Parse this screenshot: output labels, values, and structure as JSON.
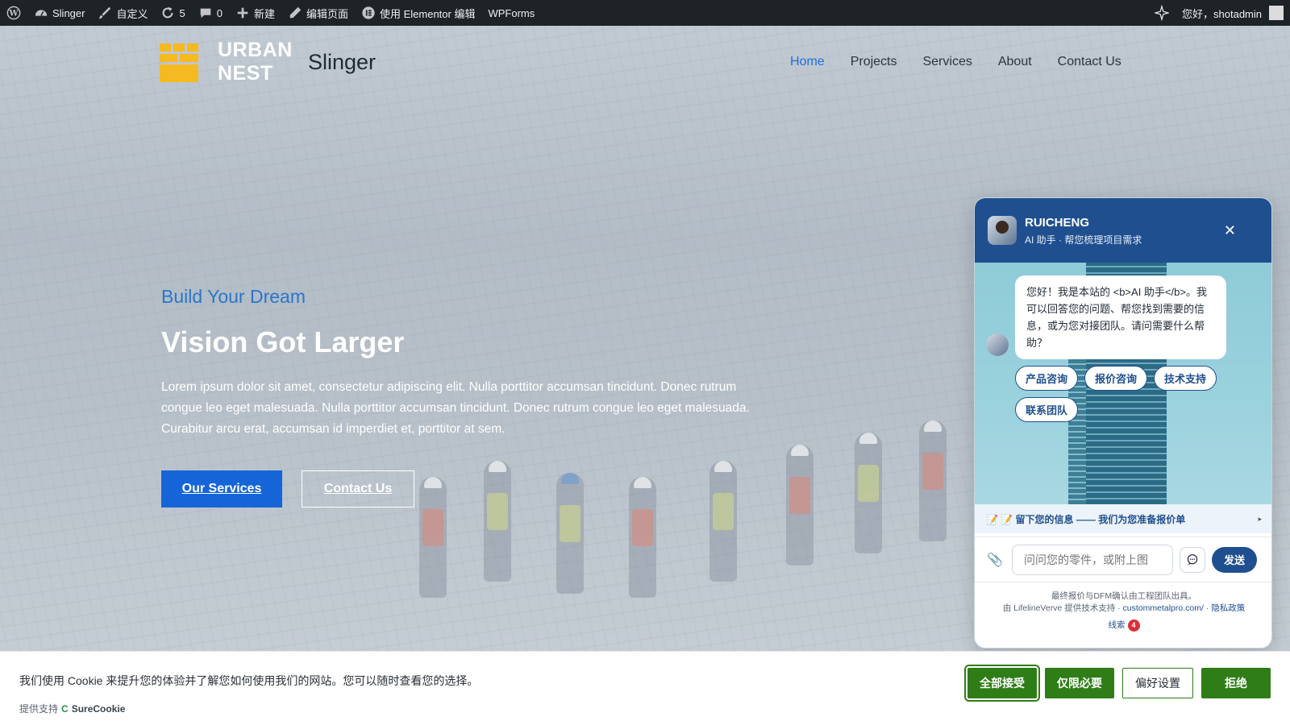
{
  "adminbar": {
    "items": [
      {
        "icon": "wordpress-icon",
        "label": ""
      },
      {
        "icon": "dashboard-icon",
        "label": "Slinger"
      },
      {
        "icon": "brush-icon",
        "label": "自定义"
      },
      {
        "icon": "refresh-icon",
        "label": "5"
      },
      {
        "icon": "comment-icon",
        "label": "0"
      },
      {
        "icon": "plus-icon",
        "label": "新建"
      },
      {
        "icon": "pencil-icon",
        "label": "编辑页面"
      },
      {
        "icon": "elementor-icon",
        "label": "使用 Elementor 编辑"
      },
      {
        "icon": "",
        "label": "WPForms"
      }
    ],
    "greeting": "您好，shotadmin",
    "ai_icon": "sparkle-icon"
  },
  "header": {
    "logo_line1": "URBAN",
    "logo_line2": "NEST",
    "site_title": "Slinger",
    "nav": [
      "Home",
      "Projects",
      "Services",
      "About",
      "Contact Us"
    ],
    "active_nav": "Home"
  },
  "hero": {
    "kicker": "Build Your Dream",
    "headline": "Vision Got Larger",
    "lead": "Lorem ipsum dolor sit amet, consectetur adipiscing elit. Nulla porttitor accumsan tincidunt. Donec rutrum congue leo eget malesuada. Nulla porttitor accumsan tincidunt. Donec rutrum congue leo eget malesuada. Curabitur arcu erat, accumsan id imperdiet et, porttitor at sem.",
    "primary_button": "Our Services",
    "secondary_button": "Contact Us"
  },
  "chat": {
    "name": "RUICHENG",
    "subtitle": "AI 助手 · 帮您梳理项目需求",
    "close_icon": "close-icon",
    "greeting": "您好！我是本站的 <b>AI 助手</b>。我可以回答您的问题、帮您找到需要的信息，或为您对接团队。请问需要什么帮助？",
    "chips": [
      "产品咨询",
      "报价咨询",
      "技术支持",
      "联系团队"
    ],
    "lead_bar": "📝 📝 留下您的信息 —— 我们为您准备报价单",
    "input_placeholder": "问问您的零件，或附上图",
    "send_label": "发送",
    "footer_line1": "最终报价与DFM确认由工程团队出具。",
    "footer_line2_prefix": "由 LifelineVerve 提供技术支持 · ",
    "footer_link": "custommetalpro.com/",
    "footer_sep": " · ",
    "footer_privacy": "隐私政策",
    "footer_badge_label": "线索",
    "footer_badge_count": "4"
  },
  "cookie": {
    "text": "我们使用 Cookie 来提升您的体验并了解您如何使用我们的网站。您可以随时查看您的选择。",
    "powered_prefix": "提供支持",
    "powered_brand": "SureCookie",
    "buttons": {
      "accept_all": "全部接受",
      "necessary_only": "仅限必要",
      "preferences": "偏好设置",
      "reject": "拒绝"
    }
  },
  "colors": {
    "accent": "#1565d8",
    "chat_primary": "#1f4f8f",
    "cookie_green": "#2f7d16",
    "logo_yellow": "#f5b921",
    "admin_bar": "#1d2327"
  }
}
